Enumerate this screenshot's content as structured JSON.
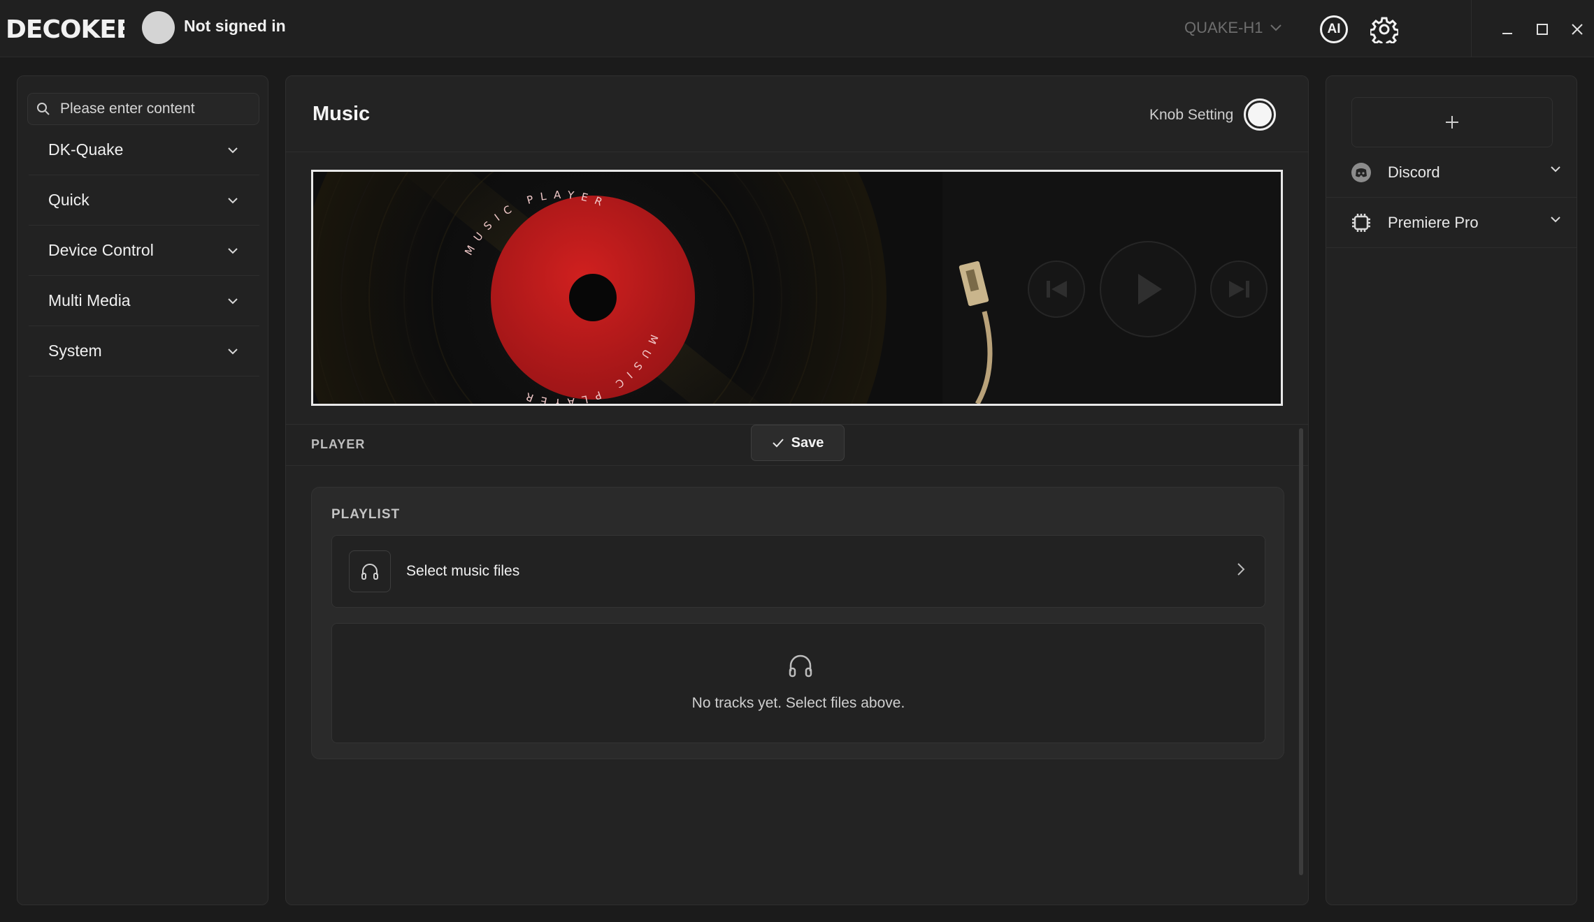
{
  "header": {
    "logo_text": "DECOKEE",
    "signin_text": "Not signed in",
    "device": "QUAKE-H1",
    "ai_label": "AI"
  },
  "sidebar": {
    "search_placeholder": "Please enter content",
    "items": [
      {
        "label": "DK-Quake"
      },
      {
        "label": "Quick"
      },
      {
        "label": "Device Control"
      },
      {
        "label": "Multi Media"
      },
      {
        "label": "System"
      }
    ]
  },
  "main": {
    "title": "Music",
    "knob_label": "Knob Setting",
    "vinyl_text_top": "MUSIC PLAYER",
    "vinyl_text_bottom": "MUSIC PLAYER",
    "player_label": "PLAYER",
    "save_label": "Save",
    "playlist_title": "PLAYLIST",
    "select_files_label": "Select music files",
    "empty_text": "No tracks yet. Select files above."
  },
  "right_panel": {
    "apps": [
      {
        "label": "Discord",
        "icon": "discord-icon"
      },
      {
        "label": "Premiere Pro",
        "icon": "chip-icon"
      }
    ]
  },
  "colors": {
    "accent_red": "#b0171a",
    "background": "#1b1b1b"
  }
}
